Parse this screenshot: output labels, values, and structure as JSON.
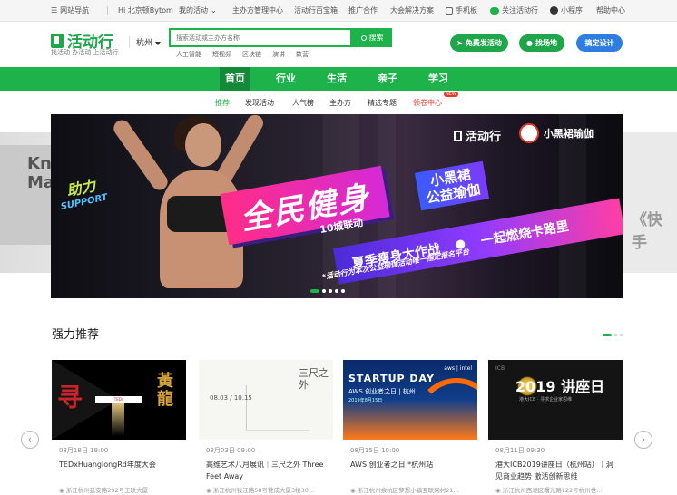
{
  "topbar": {
    "site_nav": "网站导航",
    "greeting": "Hi 北京顿Bytom",
    "my_events": "我的活动",
    "organizer_center": "主办方管理中心",
    "toolbox": "活动行百宝箱",
    "cooperation": "推广合作",
    "solutions": "大会解决方案",
    "mobile": "手机板",
    "follow": "关注活动行",
    "mini_program": "小程序",
    "help": "帮助中心"
  },
  "header": {
    "logo": "活动行",
    "slogan": "找活动  办活动  上活动行",
    "city": "杭州",
    "search_placeholder": "搜索活动或主办方名称",
    "search_button": "搜索",
    "hot_words": [
      "人工智能",
      "短视频",
      "区块链",
      "演讲",
      "数营"
    ],
    "publish_button": "免费发活动",
    "venue_button": "找场地",
    "custom_button": "搞定设计"
  },
  "main_nav": [
    "首页",
    "行业",
    "生活",
    "亲子",
    "学习"
  ],
  "sub_nav": [
    "推荐",
    "发现活动",
    "人气榜",
    "主办方",
    "精选专题",
    "领卷中心"
  ],
  "new_badge": "NEW",
  "banner": {
    "brand": "活动行",
    "partner": "小黑裙瑜伽",
    "support_cn": "助力",
    "support_en": "SUPPORT",
    "main_title": "全民健身",
    "city_linked": "10城联动",
    "tag_line1": "小黑裙",
    "tag_line2": "公益瑜伽",
    "slogan_left": "夏季瘦身大作战",
    "slogan_right": "一起燃烧卡路里",
    "note": "*活动行为本次公益瑜伽活动唯一指定报名平台",
    "side_left": "Kn Ma",
    "side_right": "《快手"
  },
  "recommend": {
    "title": "强力推荐",
    "cards": [
      {
        "thumb_title": "寻 黄龍",
        "date": "08月18日",
        "time": "19:00",
        "title": "TEDxHuanglongRd年度大会",
        "address": "浙江杭州延安路292号工联大厦"
      },
      {
        "thumb_title": "三尺之外",
        "thumb_dates": "08.03 / 10.15",
        "date": "08月03日",
        "time": "09:00",
        "title": "高维艺术八月展讯｜三尺之外 Three Feet Away",
        "address": "浙江杭州钱江路58号赞成大厦3楼30..."
      },
      {
        "thumb_title": "STARTUP DAY",
        "thumb_sub": "AWS 创业者之日 | 杭州",
        "thumb_date": "2019年8月15日",
        "date": "08月15日",
        "time": "10:00",
        "title": "AWS 创业者之日 *杭州站",
        "address": "浙江杭州余杭区梦想小镇互联网村21..."
      },
      {
        "thumb_title": "2019 讲座日",
        "thumb_sub": "港大ICB · 寻求企业家思维",
        "date": "08月11日",
        "time": "09:30",
        "title": "港大ICB2019讲座日（杭州站）｜洞见商业趋势 激活创新思维",
        "address": "浙江杭州西湖区曙光路122号杭州世..."
      }
    ]
  },
  "colors": {
    "brand_green": "#1db24a",
    "nav_active": "#138a37",
    "blue": "#2f7de1",
    "red": "#e8382c"
  }
}
